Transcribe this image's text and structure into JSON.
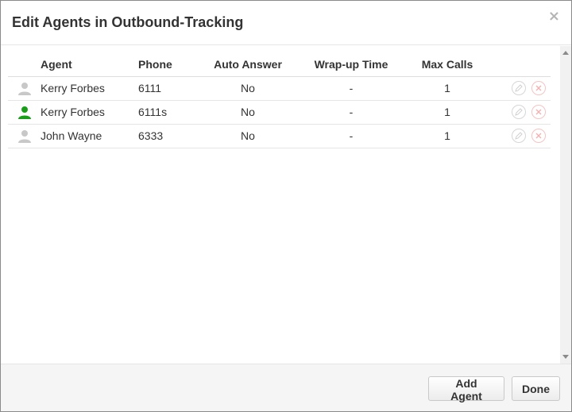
{
  "modal": {
    "title": "Edit Agents in Outbound-Tracking",
    "close_label": "×"
  },
  "table": {
    "headers": {
      "agent": "Agent",
      "phone": "Phone",
      "auto_answer": "Auto Answer",
      "wrapup": "Wrap-up Time",
      "max_calls": "Max Calls"
    },
    "rows": [
      {
        "agent": "Kerry Forbes",
        "phone": "6111",
        "auto_answer": "No",
        "wrapup": "-",
        "max_calls": "1",
        "status_color": "#c8c8c8"
      },
      {
        "agent": "Kerry Forbes",
        "phone": "6111s",
        "auto_answer": "No",
        "wrapup": "-",
        "max_calls": "1",
        "status_color": "#1a9e1a"
      },
      {
        "agent": "John Wayne",
        "phone": "6333",
        "auto_answer": "No",
        "wrapup": "-",
        "max_calls": "1",
        "status_color": "#c8c8c8"
      }
    ]
  },
  "footer": {
    "add_agent_label": "Add Agent",
    "done_label": "Done"
  },
  "icons": {
    "user": "user-icon",
    "edit": "edit-icon",
    "delete": "delete-icon",
    "close": "close-icon"
  }
}
